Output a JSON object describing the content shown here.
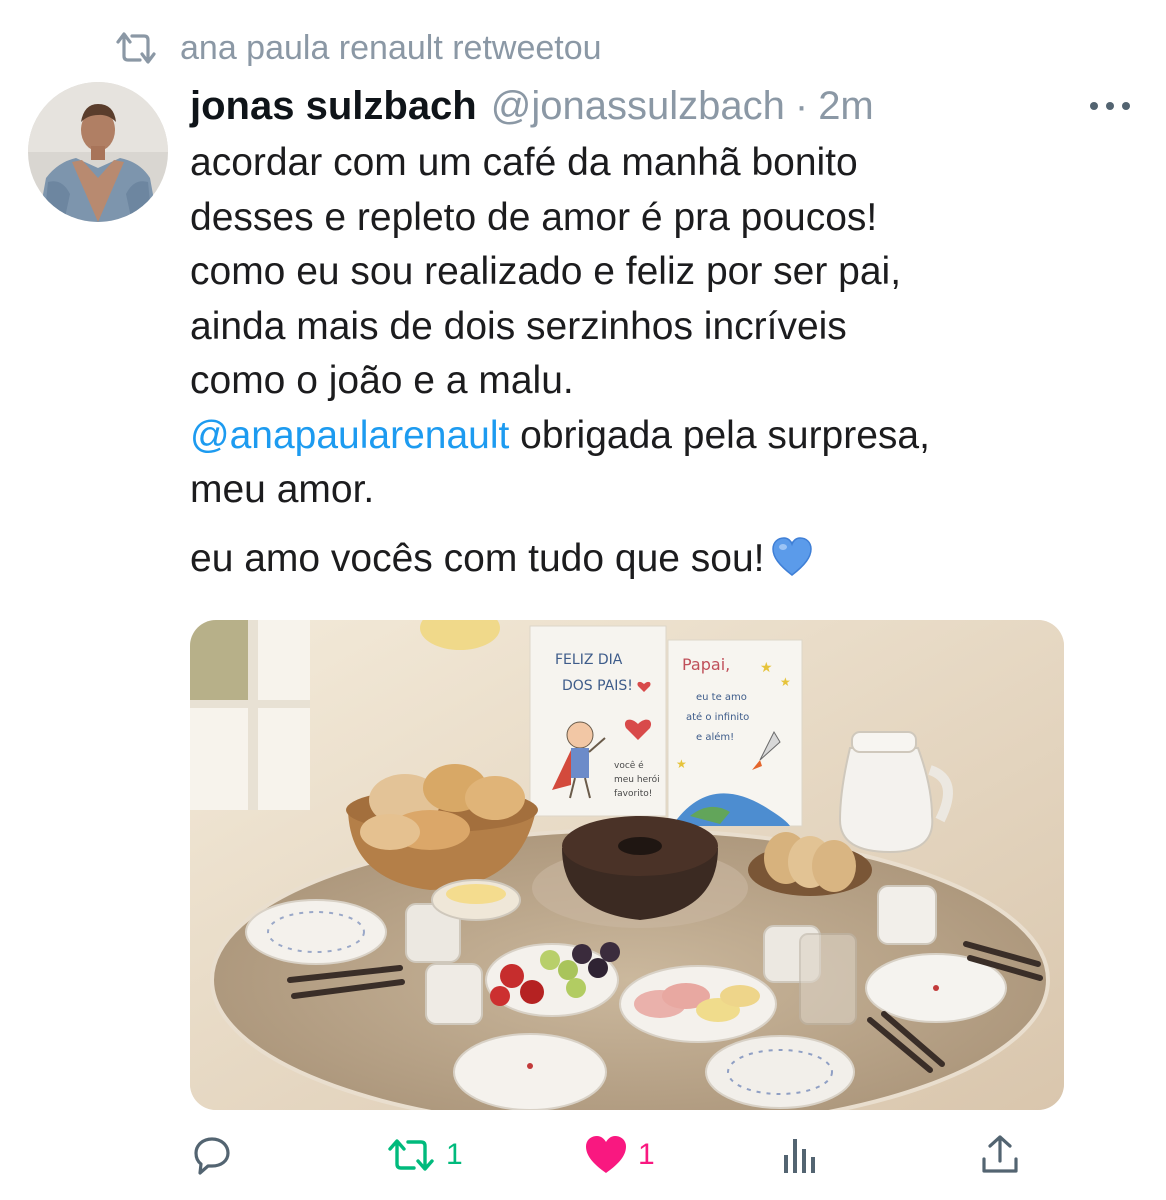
{
  "retweet_context": {
    "text": "ana paula renault retweetou",
    "icon": "retweet-icon"
  },
  "author": {
    "name": "jonas sulzbach",
    "handle": "@jonassulzbach",
    "separator": "·",
    "time": "2m",
    "avatar": "avatar-photo"
  },
  "tweet": {
    "lines": [
      "acordar com um café da manhã bonito",
      "desses e repleto de amor é pra poucos!",
      "como eu sou realizado e feliz por ser pai,",
      "ainda mais de dois serzinhos incríveis",
      "como o joão e a malu."
    ],
    "mention": "@anapaularenault",
    "mention_rest": " obrigada pela surpresa,",
    "line_after_mention": "meu amor.",
    "closing": "eu amo vocês com tudo que sou!",
    "closing_emoji": "blue-heart-emoji"
  },
  "media": {
    "card_left": {
      "line1": "FELIZ DIA",
      "line2": "DOS PAIS!",
      "note1": "você é",
      "note2": "meu herói",
      "note3": "favorito!"
    },
    "card_right": {
      "line1": "Papai,",
      "line2": "eu te amo",
      "line3": "até o infinito",
      "line4": "e além!"
    }
  },
  "actions": {
    "reply": {
      "icon": "reply-icon",
      "count": ""
    },
    "retweet": {
      "icon": "retweet-icon",
      "count": "1",
      "color": "#00ba7c"
    },
    "like": {
      "icon": "heart-icon",
      "count": "1",
      "color": "#f91880"
    },
    "stats": {
      "icon": "stats-icon"
    },
    "share": {
      "icon": "share-icon"
    }
  },
  "colors": {
    "accent": "#1d9bf0",
    "muted": "#8b98a5",
    "retweet_green": "#00ba7c",
    "like_pink": "#f91880"
  }
}
